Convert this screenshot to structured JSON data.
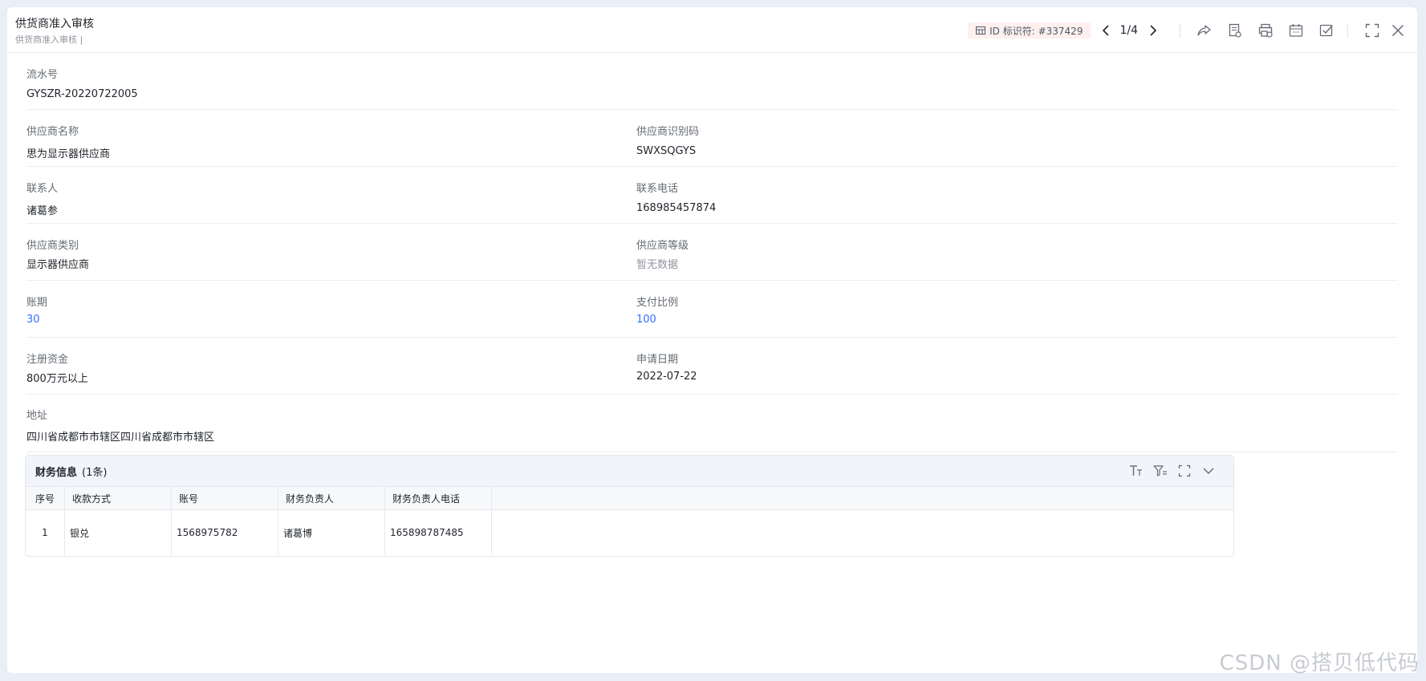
{
  "header": {
    "title": "供货商准入审核",
    "subtitle": "供货商准入审核 |",
    "id_label": "ID 标识符: #337429",
    "pager": "1/4"
  },
  "fields": {
    "serial": {
      "label": "流水号",
      "value": "GYSZR-20220722005"
    },
    "supplier_name": {
      "label": "供应商名称",
      "value": "思为显示器供应商"
    },
    "supplier_code": {
      "label": "供应商识别码",
      "value": "SWXSQGYS"
    },
    "contact": {
      "label": "联系人",
      "value": "诸葛参"
    },
    "phone": {
      "label": "联系电话",
      "value": "168985457874"
    },
    "category": {
      "label": "供应商类别",
      "value": "显示器供应商"
    },
    "level": {
      "label": "供应商等级",
      "value": "暂无数据"
    },
    "account_period": {
      "label": "账期",
      "value": "30"
    },
    "payment_ratio": {
      "label": "支付比例",
      "value": "100"
    },
    "registered_capital": {
      "label": "注册资金",
      "value": "800万元以上"
    },
    "apply_date": {
      "label": "申请日期",
      "value": "2022-07-22"
    },
    "address": {
      "label": "地址",
      "value": "四川省成都市市辖区四川省成都市市辖区"
    }
  },
  "finance": {
    "title": "财务信息",
    "count": "(1条)",
    "columns": [
      "序号",
      "收款方式",
      "账号",
      "财务负责人",
      "财务负责人电话"
    ],
    "rows": [
      [
        "1",
        "银兑",
        "1568975782",
        "诸葛博",
        "165898787485"
      ]
    ]
  },
  "watermark": "CSDN @搭贝低代码",
  "colors": {
    "link": "#3370ff",
    "background": "#e9eef7"
  }
}
